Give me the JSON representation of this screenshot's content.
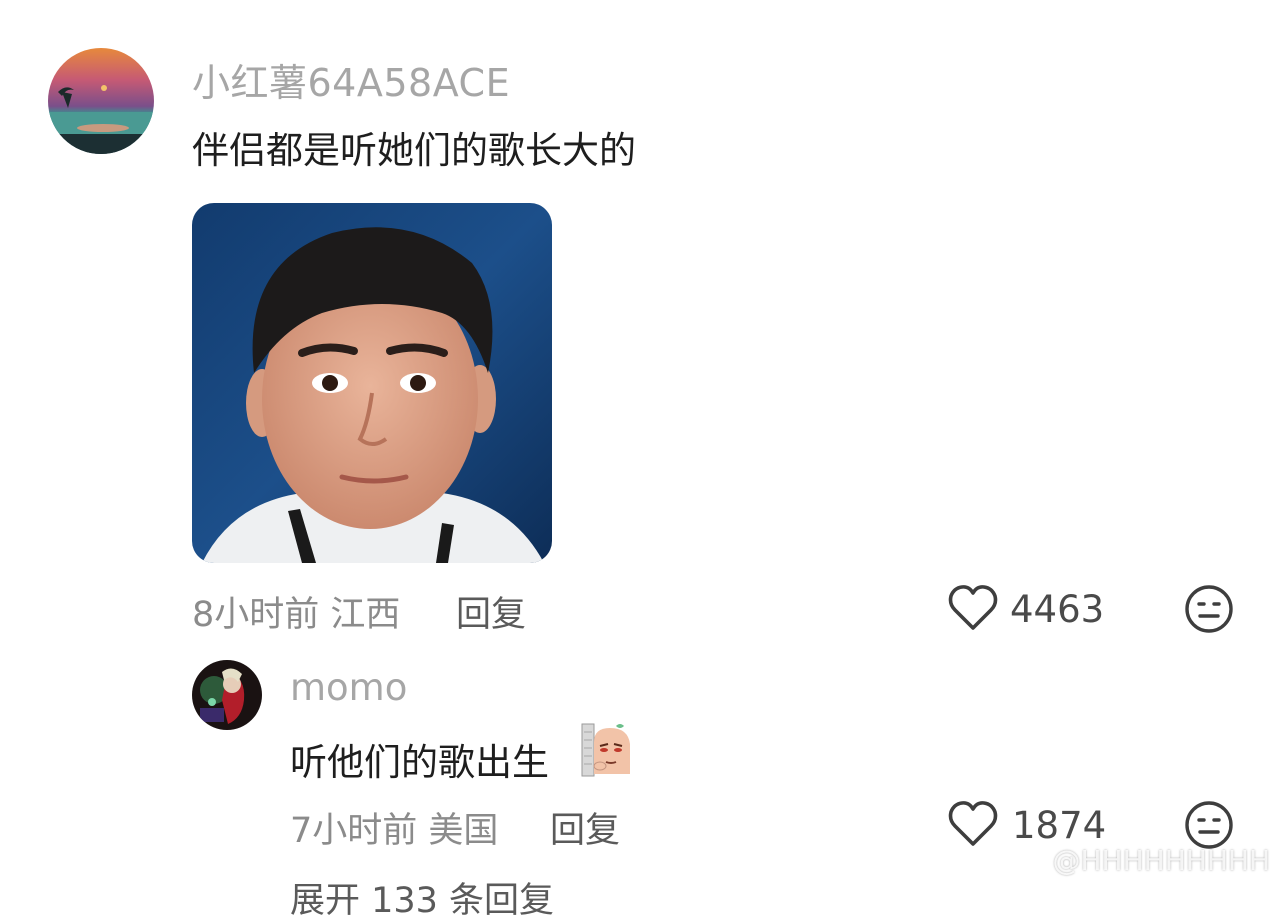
{
  "comments": [
    {
      "username": "小红薯64A58ACE",
      "text": "伴侣都是听她们的歌长大的",
      "time_location": "8小时前 江西",
      "reply_label": "回复",
      "likes": "4463"
    },
    {
      "username": "momo",
      "text": "听他们的歌出生",
      "time_location": "7小时前 美国",
      "reply_label": "回复",
      "likes": "1874"
    }
  ],
  "more_replies": "展开 133 条回复",
  "watermark": "@HHHHHHHHH",
  "icons": {
    "like": "heart-outline-icon",
    "reaction": "neutral-face-icon"
  },
  "colors": {
    "username": "#a6a6a6",
    "meta": "#8b8b8b",
    "text": "#1e1e1e"
  }
}
